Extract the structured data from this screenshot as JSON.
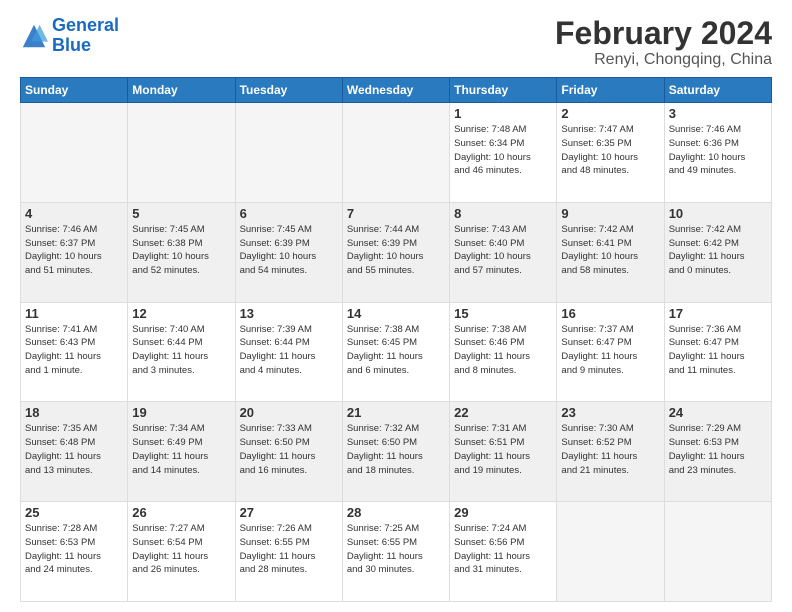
{
  "header": {
    "logo_line1": "General",
    "logo_line2": "Blue",
    "title": "February 2024",
    "subtitle": "Renyi, Chongqing, China"
  },
  "weekdays": [
    "Sunday",
    "Monday",
    "Tuesday",
    "Wednesday",
    "Thursday",
    "Friday",
    "Saturday"
  ],
  "weeks": [
    {
      "shaded": false,
      "days": [
        {
          "num": "",
          "info": "",
          "empty": true
        },
        {
          "num": "",
          "info": "",
          "empty": true
        },
        {
          "num": "",
          "info": "",
          "empty": true
        },
        {
          "num": "",
          "info": "",
          "empty": true
        },
        {
          "num": "1",
          "info": "Sunrise: 7:48 AM\nSunset: 6:34 PM\nDaylight: 10 hours\nand 46 minutes.",
          "empty": false
        },
        {
          "num": "2",
          "info": "Sunrise: 7:47 AM\nSunset: 6:35 PM\nDaylight: 10 hours\nand 48 minutes.",
          "empty": false
        },
        {
          "num": "3",
          "info": "Sunrise: 7:46 AM\nSunset: 6:36 PM\nDaylight: 10 hours\nand 49 minutes.",
          "empty": false
        }
      ]
    },
    {
      "shaded": true,
      "days": [
        {
          "num": "4",
          "info": "Sunrise: 7:46 AM\nSunset: 6:37 PM\nDaylight: 10 hours\nand 51 minutes.",
          "empty": false
        },
        {
          "num": "5",
          "info": "Sunrise: 7:45 AM\nSunset: 6:38 PM\nDaylight: 10 hours\nand 52 minutes.",
          "empty": false
        },
        {
          "num": "6",
          "info": "Sunrise: 7:45 AM\nSunset: 6:39 PM\nDaylight: 10 hours\nand 54 minutes.",
          "empty": false
        },
        {
          "num": "7",
          "info": "Sunrise: 7:44 AM\nSunset: 6:39 PM\nDaylight: 10 hours\nand 55 minutes.",
          "empty": false
        },
        {
          "num": "8",
          "info": "Sunrise: 7:43 AM\nSunset: 6:40 PM\nDaylight: 10 hours\nand 57 minutes.",
          "empty": false
        },
        {
          "num": "9",
          "info": "Sunrise: 7:42 AM\nSunset: 6:41 PM\nDaylight: 10 hours\nand 58 minutes.",
          "empty": false
        },
        {
          "num": "10",
          "info": "Sunrise: 7:42 AM\nSunset: 6:42 PM\nDaylight: 11 hours\nand 0 minutes.",
          "empty": false
        }
      ]
    },
    {
      "shaded": false,
      "days": [
        {
          "num": "11",
          "info": "Sunrise: 7:41 AM\nSunset: 6:43 PM\nDaylight: 11 hours\nand 1 minute.",
          "empty": false
        },
        {
          "num": "12",
          "info": "Sunrise: 7:40 AM\nSunset: 6:44 PM\nDaylight: 11 hours\nand 3 minutes.",
          "empty": false
        },
        {
          "num": "13",
          "info": "Sunrise: 7:39 AM\nSunset: 6:44 PM\nDaylight: 11 hours\nand 4 minutes.",
          "empty": false
        },
        {
          "num": "14",
          "info": "Sunrise: 7:38 AM\nSunset: 6:45 PM\nDaylight: 11 hours\nand 6 minutes.",
          "empty": false
        },
        {
          "num": "15",
          "info": "Sunrise: 7:38 AM\nSunset: 6:46 PM\nDaylight: 11 hours\nand 8 minutes.",
          "empty": false
        },
        {
          "num": "16",
          "info": "Sunrise: 7:37 AM\nSunset: 6:47 PM\nDaylight: 11 hours\nand 9 minutes.",
          "empty": false
        },
        {
          "num": "17",
          "info": "Sunrise: 7:36 AM\nSunset: 6:47 PM\nDaylight: 11 hours\nand 11 minutes.",
          "empty": false
        }
      ]
    },
    {
      "shaded": true,
      "days": [
        {
          "num": "18",
          "info": "Sunrise: 7:35 AM\nSunset: 6:48 PM\nDaylight: 11 hours\nand 13 minutes.",
          "empty": false
        },
        {
          "num": "19",
          "info": "Sunrise: 7:34 AM\nSunset: 6:49 PM\nDaylight: 11 hours\nand 14 minutes.",
          "empty": false
        },
        {
          "num": "20",
          "info": "Sunrise: 7:33 AM\nSunset: 6:50 PM\nDaylight: 11 hours\nand 16 minutes.",
          "empty": false
        },
        {
          "num": "21",
          "info": "Sunrise: 7:32 AM\nSunset: 6:50 PM\nDaylight: 11 hours\nand 18 minutes.",
          "empty": false
        },
        {
          "num": "22",
          "info": "Sunrise: 7:31 AM\nSunset: 6:51 PM\nDaylight: 11 hours\nand 19 minutes.",
          "empty": false
        },
        {
          "num": "23",
          "info": "Sunrise: 7:30 AM\nSunset: 6:52 PM\nDaylight: 11 hours\nand 21 minutes.",
          "empty": false
        },
        {
          "num": "24",
          "info": "Sunrise: 7:29 AM\nSunset: 6:53 PM\nDaylight: 11 hours\nand 23 minutes.",
          "empty": false
        }
      ]
    },
    {
      "shaded": false,
      "days": [
        {
          "num": "25",
          "info": "Sunrise: 7:28 AM\nSunset: 6:53 PM\nDaylight: 11 hours\nand 24 minutes.",
          "empty": false
        },
        {
          "num": "26",
          "info": "Sunrise: 7:27 AM\nSunset: 6:54 PM\nDaylight: 11 hours\nand 26 minutes.",
          "empty": false
        },
        {
          "num": "27",
          "info": "Sunrise: 7:26 AM\nSunset: 6:55 PM\nDaylight: 11 hours\nand 28 minutes.",
          "empty": false
        },
        {
          "num": "28",
          "info": "Sunrise: 7:25 AM\nSunset: 6:55 PM\nDaylight: 11 hours\nand 30 minutes.",
          "empty": false
        },
        {
          "num": "29",
          "info": "Sunrise: 7:24 AM\nSunset: 6:56 PM\nDaylight: 11 hours\nand 31 minutes.",
          "empty": false
        },
        {
          "num": "",
          "info": "",
          "empty": true
        },
        {
          "num": "",
          "info": "",
          "empty": true
        }
      ]
    }
  ]
}
